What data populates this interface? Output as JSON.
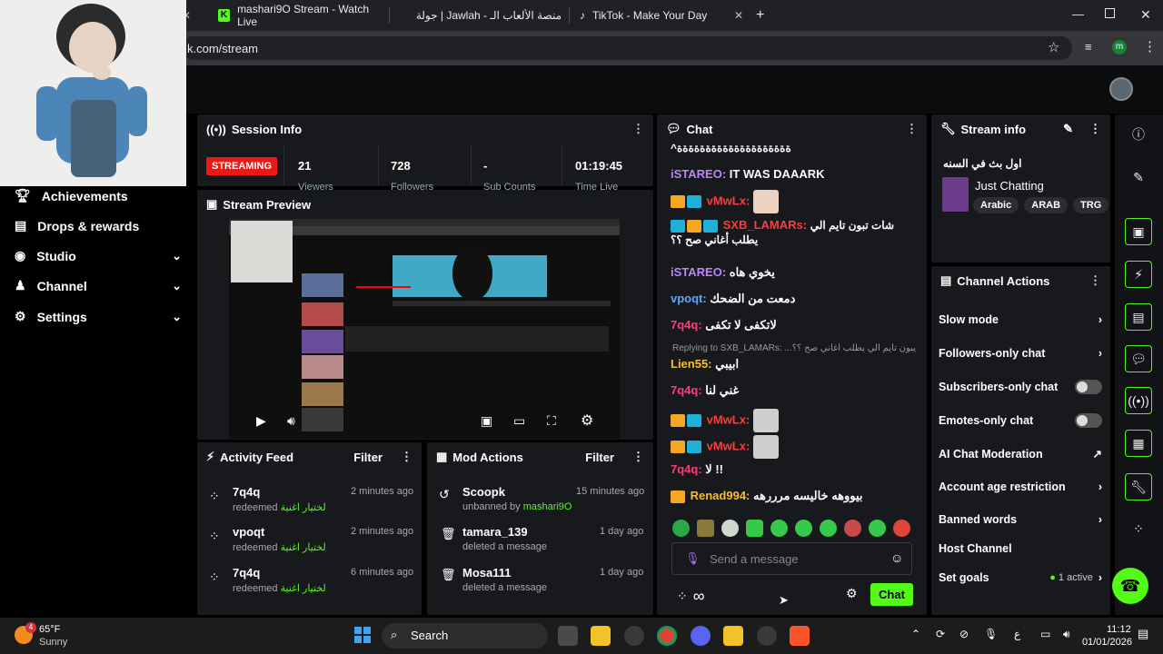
{
  "browser": {
    "tabs": [
      {
        "label": "mashari9O Stream - Watch Live",
        "icon": "kick-icon"
      },
      {
        "label": "منصة الألعاب الـ - Jawlah | جولة",
        "icon": "jawlah-icon"
      },
      {
        "label": "TikTok - Make Your Day",
        "icon": "tiktok-icon"
      }
    ],
    "url": "k.com/stream",
    "profile_initial": "m"
  },
  "session": {
    "title": "Session Info",
    "live_badge": "STREAMING",
    "stats": [
      {
        "value": "21",
        "label": "Viewers"
      },
      {
        "value": "728",
        "label": "Followers"
      },
      {
        "value": "-",
        "label": "Sub Counts"
      },
      {
        "value": "01:19:45",
        "label": "Time Live"
      }
    ]
  },
  "preview": {
    "title": "Stream Preview"
  },
  "sidebar": {
    "items": [
      {
        "label": "Achievements",
        "icon": "trophy-icon"
      },
      {
        "label": "Drops & rewards",
        "icon": "drops-icon"
      },
      {
        "label": "Studio",
        "icon": "studio-icon",
        "chevron": true
      },
      {
        "label": "Channel",
        "icon": "channel-icon",
        "chevron": true
      },
      {
        "label": "Settings",
        "icon": "gear-icon",
        "chevron": true
      }
    ]
  },
  "activity": {
    "title": "Activity Feed",
    "filter": "Filter",
    "items": [
      {
        "name": "7q4q",
        "action": "redeemed",
        "reward": "لختيار اغنية",
        "time": "2 minutes ago"
      },
      {
        "name": "vpoqt",
        "action": "redeemed",
        "reward": "لختيار اغنية",
        "time": "2 minutes ago"
      },
      {
        "name": "7q4q",
        "action": "redeemed",
        "reward": "لختيار اغنية",
        "time": "6 minutes ago"
      }
    ]
  },
  "mod": {
    "title": "Mod Actions",
    "filter": "Filter",
    "items": [
      {
        "name": "Scoopk",
        "sub": "unbanned by",
        "by": "mashari9O",
        "time": "15 minutes ago",
        "icon": "undo-icon"
      },
      {
        "name": "tamara_139",
        "sub": "deleted a message",
        "by": "",
        "time": "1 day ago",
        "icon": "trash-icon"
      },
      {
        "name": "Mosa111",
        "sub": "deleted a message",
        "by": "",
        "time": "1 day ago",
        "icon": "trash-icon"
      }
    ]
  },
  "chat": {
    "title": "Chat",
    "top_line": "^ةةةةةةةةةةةةةةةةةةةة",
    "messages": [
      {
        "user": "iSTAREO:",
        "text": "IT WAS DAAARK",
        "color": "#c084fc"
      },
      {
        "user": "vMwLx:",
        "text": "",
        "color": "#ff3b3b"
      },
      {
        "user": "SXB_LAMARs:",
        "text": "شات تبون تايم الي يطلب أغاني صح ؟؟",
        "color": "#ff3b3b"
      },
      {
        "user": "iSTAREO:",
        "text": "يخوي هاه",
        "color": "#c084fc"
      },
      {
        "user": "vpoqt:",
        "text": "دمعت من الضحك",
        "color": "#60a5fa"
      },
      {
        "user": "7q4q:",
        "text": "لاتكفى لا تكفى",
        "color": "#ff3b7a"
      },
      {
        "user": "Lien55:",
        "text": "ابيبي",
        "color": "#fbbf24"
      },
      {
        "user": "7q4q:",
        "text": "غني لنا",
        "color": "#ff3b7a"
      },
      {
        "user": "vMwLx:",
        "text": "",
        "color": "#ff3b3b"
      },
      {
        "user": "vMwLx:",
        "text": "",
        "color": "#ff3b3b"
      },
      {
        "user": "7q4q:",
        "text": "لا !!",
        "color": "#ff3b7a"
      },
      {
        "user": "Renad994:",
        "text": "بيووهه خاليسه مرررهه",
        "color": "#fbbf24"
      }
    ],
    "reply_hint": "Replying to SXB_LAMARs: ...يبون تايم الي يطلب أغاني صح ؟؟",
    "placeholder": "Send a message",
    "send_label": "Chat",
    "points": "∞"
  },
  "stream_info": {
    "title": "Stream info",
    "stream_title": "اول بث في السنه",
    "category": "Just Chatting",
    "tags": [
      "Arabic",
      "ARAB",
      "TRG"
    ]
  },
  "channel_actions": {
    "title": "Channel Actions",
    "items": [
      {
        "label": "Slow mode",
        "control": "chevron"
      },
      {
        "label": "Followers-only chat",
        "control": "chevron"
      },
      {
        "label": "Subscribers-only chat",
        "control": "toggle"
      },
      {
        "label": "Emotes-only chat",
        "control": "toggle"
      },
      {
        "label": "AI Chat Moderation",
        "control": "external"
      },
      {
        "label": "Account age restriction",
        "control": "chevron"
      },
      {
        "label": "Banned words",
        "control": "chevron"
      },
      {
        "label": "Host Channel",
        "control": ""
      },
      {
        "label": "Set goals",
        "control": "chevron",
        "status": "1 active"
      }
    ]
  },
  "taskbar": {
    "weather_temp": "65°F",
    "weather_desc": "Sunny",
    "weather_badge": "4",
    "search": "Search",
    "time": "11:12",
    "date": "01/01/2026",
    "lang": "ع"
  },
  "colors": {
    "accent": "#53fc18",
    "panel": "#18191c",
    "bg": "#000000",
    "live": "#e91916"
  }
}
